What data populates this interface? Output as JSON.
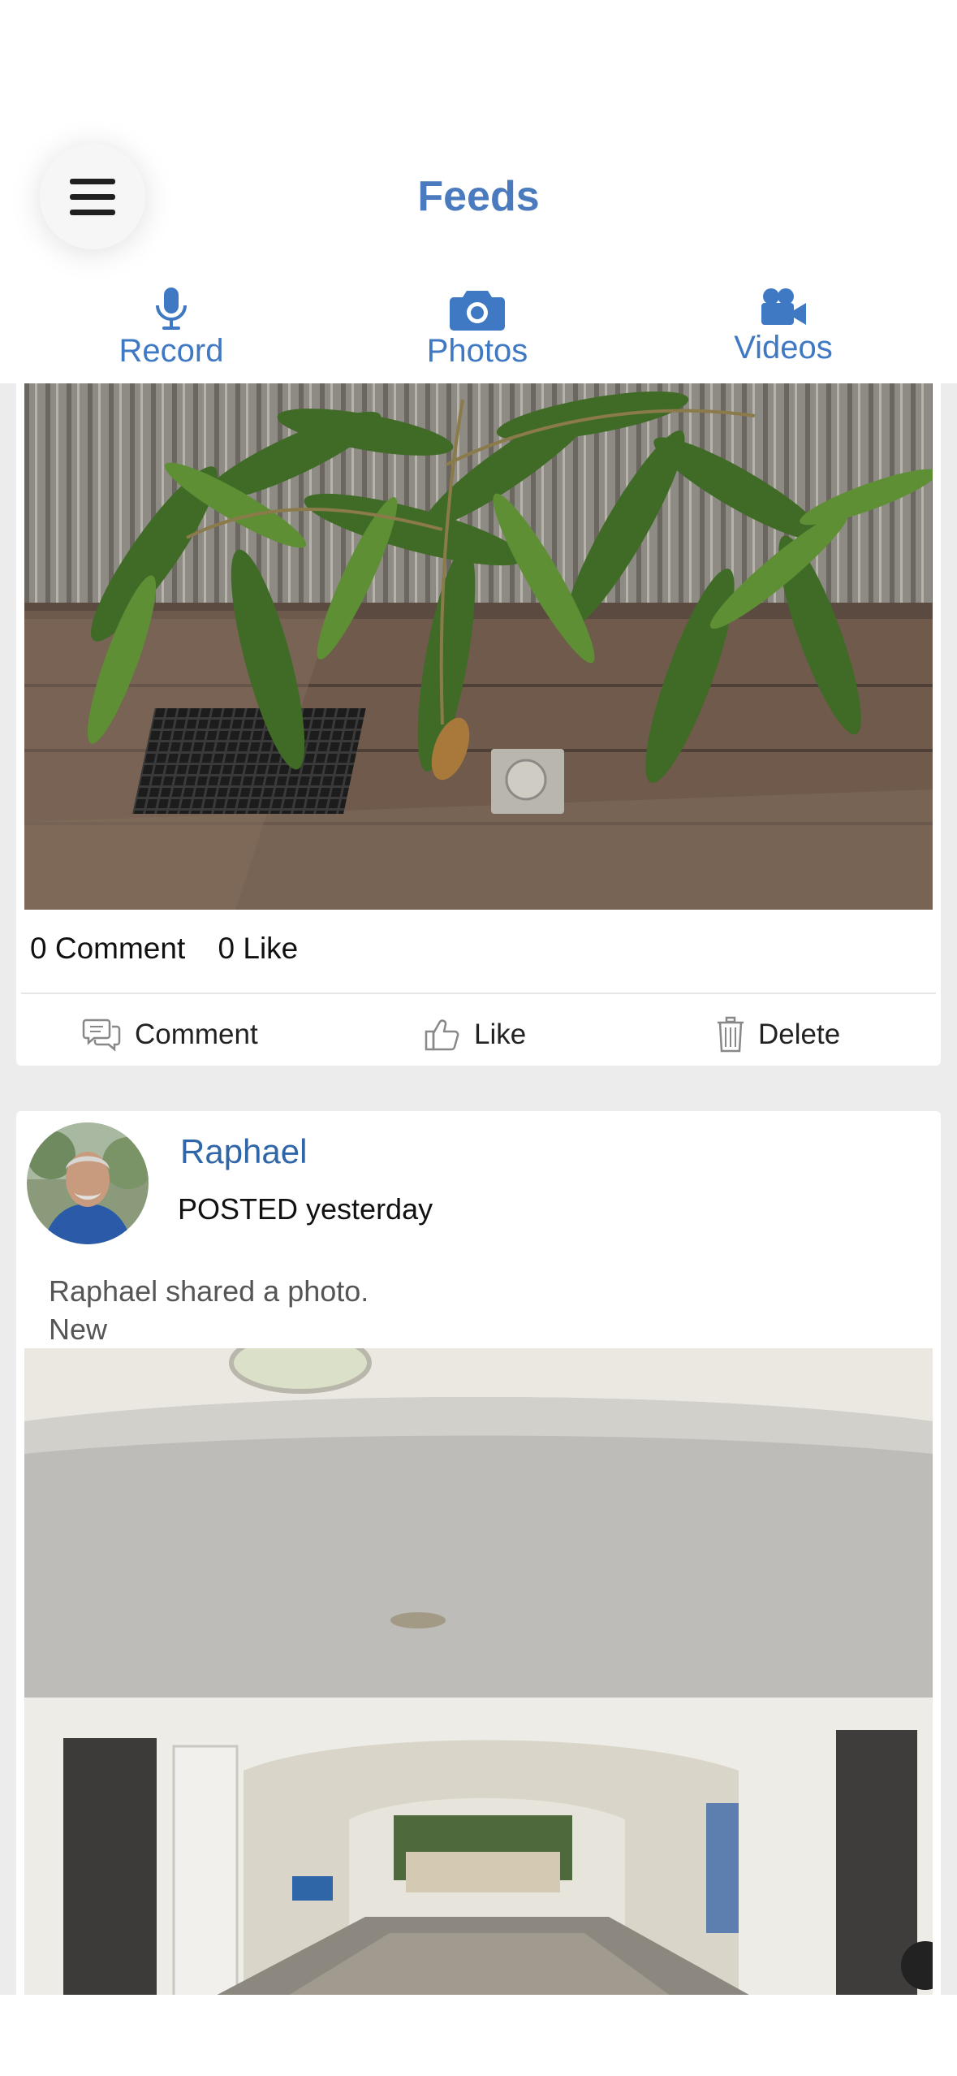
{
  "header": {
    "title": "Feeds",
    "menu_icon": "hamburger-menu-icon",
    "tabs": [
      {
        "label": "Record",
        "icon": "microphone-icon"
      },
      {
        "label": "Photos",
        "icon": "camera-icon"
      },
      {
        "label": "Videos",
        "icon": "video-camera-icon"
      }
    ],
    "accent_color": "#3f78c3"
  },
  "feed": {
    "posts": [
      {
        "photo_subject": "potted mango tree leaves on wooden deck",
        "stats": {
          "comments": "0 Comment",
          "likes": "0 Like"
        },
        "actions": {
          "comment": "Comment",
          "like": "Like",
          "delete": "Delete"
        }
      },
      {
        "author": "Raphael",
        "posted": "POSTED yesterday",
        "text": "Raphael shared a photo.",
        "badge": "New",
        "photo_subject": "covered passageway between white stone buildings"
      }
    ]
  }
}
